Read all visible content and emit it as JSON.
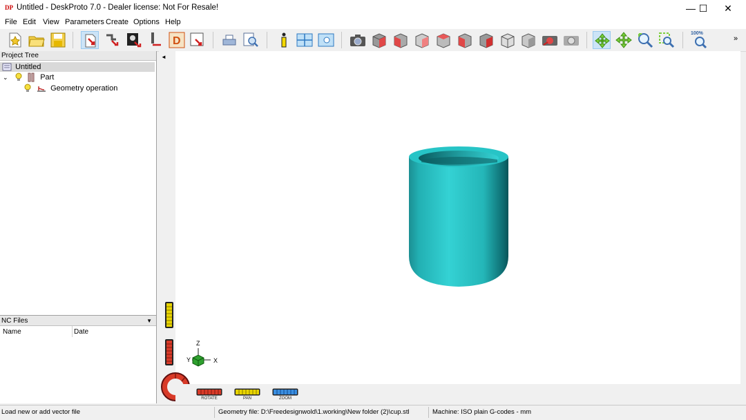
{
  "window": {
    "app_icon": "DP",
    "title": "Untitled - DeskProto 7.0 - Dealer license: Not For Resale!",
    "minimize": "—",
    "maximize": "☐",
    "close": "✕"
  },
  "menu": [
    "File",
    "Edit",
    "View",
    "Parameters",
    "Create",
    "Options",
    "Help"
  ],
  "toolbar": {
    "zoom_100_label": "100%",
    "overflow": "»"
  },
  "project_tree": {
    "header": "Project Tree",
    "root": "Untitled",
    "part": "Part",
    "operation": "Geometry operation"
  },
  "nc_files": {
    "header": "NC Files",
    "columns": [
      "Name",
      "Date"
    ]
  },
  "view_controls": {
    "rotate_label": "ROTATE",
    "pan_label": "PAN",
    "zoom_label": "ZOOM",
    "collapse_arrow": "◄"
  },
  "axes": {
    "z": "Z",
    "y": "Y",
    "x": "X"
  },
  "model": {
    "color": "#2bbfc0"
  },
  "status": {
    "hint": "Load new or add vector file",
    "geometry_file": "Geometry file: D:\\Freedesignwold\\1.working\\New folder (2)\\cup.stl",
    "machine": "Machine: ISO plain G-codes - mm"
  }
}
